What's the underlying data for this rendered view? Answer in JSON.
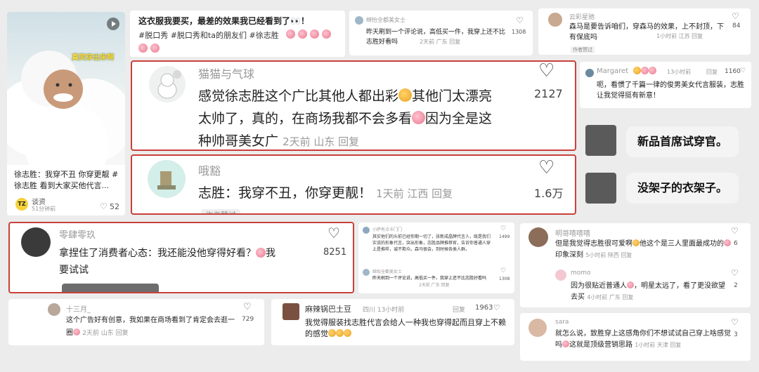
{
  "post": {
    "title": "徐志胜：我穿不丑 你穿更靓 # 徐志胜 看到大家买他代言...",
    "image_banner": "真笑穿出来啊",
    "author": "谈资",
    "author_badge": "TZ",
    "likes": "52",
    "time": "51分钟前"
  },
  "c1": {
    "text": "这衣服我要买，最差的效果我已经看到了👀！",
    "tags": "#脱口秀 #脱口秀和ta的朋友们 #徐志胜"
  },
  "c2": {
    "user": "猫猫与气球",
    "line1": "感觉徐志胜这个广比其他人都出彩",
    "line1b": "其他门太漂亮",
    "line2a": "太帅了，真的，在商场我都不会多看",
    "line2b": "因为全是这",
    "line3": "种帅哥美女广",
    "meta": "2天前 山东 回复",
    "likes": "2127"
  },
  "c3": {
    "user": "哦豁",
    "text": "志胜：我穿不丑，你穿更靓！",
    "meta": "1天前 江西 回复",
    "likes": "1.6万",
    "below": "作者赞过"
  },
  "c4": {
    "user": "零肆零玖",
    "text_a": "拿捏住了消费者心态：我还能没他穿得好看？",
    "text_b": "我",
    "text_c": "要试试",
    "likes": "8251"
  },
  "c5": {
    "user": "十三月_",
    "text": "这个广告好有创意，我如果在商场看到了肯定会去逛一圈",
    "meta": "2天前 山东 回复",
    "likes": "729"
  },
  "c6": {
    "user": "麻辣锅巴土豆",
    "meta_top": "四川 13小时前",
    "reply": "回复",
    "likes": "1963",
    "text": "我觉得服装找志胜代言会给人一种我也穿得起而且穿上不赖的感觉"
  },
  "c7": {
    "user": "绵怡全都美女士",
    "text": "昨天刷到一个评论说，高低买一件，我穿上还不比志胜好看吗",
    "meta": "2天前 广东 回复",
    "likes": "1308"
  },
  "c8": {
    "user": "云彩星驰",
    "text": "森马是要告诉咱们，穿森马的效果，上不封顶，下有保底吗",
    "meta": "1小时前 江苏 回复",
    "likes": "84",
    "below": "作者赞过"
  },
  "c9": {
    "user": "Margaret",
    "time": "13小时前",
    "reply": "回复",
    "likes": "1160",
    "text": "呃，看惯了千篇一律的俊男美女代言服装，志胜让我觉得挺有新意！"
  },
  "bubbles": {
    "b1": "新品首席试穿官。",
    "b2": "没架子的衣架子。"
  },
  "c10": {
    "user1": "小萨有点卡门门",
    "text1": "其实他们的头前已经你期一切了，张新成晶牌代言人，既是我们实说的形象代言，突出形象，志胜品牌推荐官，告诉你普通人穿上是推样，诚不欺众。森马很会，到时候各类人群。",
    "likes1": "1499",
    "user2": "绵怡全都美女士",
    "text2": "昨天刷到一个评论说，高低买一件，我穿上还不比志胜好看吗",
    "meta2": "2天前 广东 回复",
    "likes2": "1308"
  },
  "c11": {
    "user": "明哥嘻嘻嘻",
    "text": "但是我觉得志胜很可爱啊",
    "text_b": "他这个是三人里面最成功的",
    "text_c": "印象深刻",
    "meta": "5小时前 陕西 回复",
    "likes": "6",
    "reply_user": "momo",
    "reply_text": "因为很贴近普通人",
    "reply_text_b": "，明星太远了，看了更没欲望去买",
    "reply_meta": "4小时前 广东 回复",
    "reply_likes": "2"
  },
  "c12": {
    "user": "sara",
    "text": "就怎么说，致胜穿上这感角你们不想试试自己穿上啥感觉吗",
    "text_b": "这就是顶级营销思路",
    "meta": "1小时前 天津 回复",
    "likes": "3"
  }
}
